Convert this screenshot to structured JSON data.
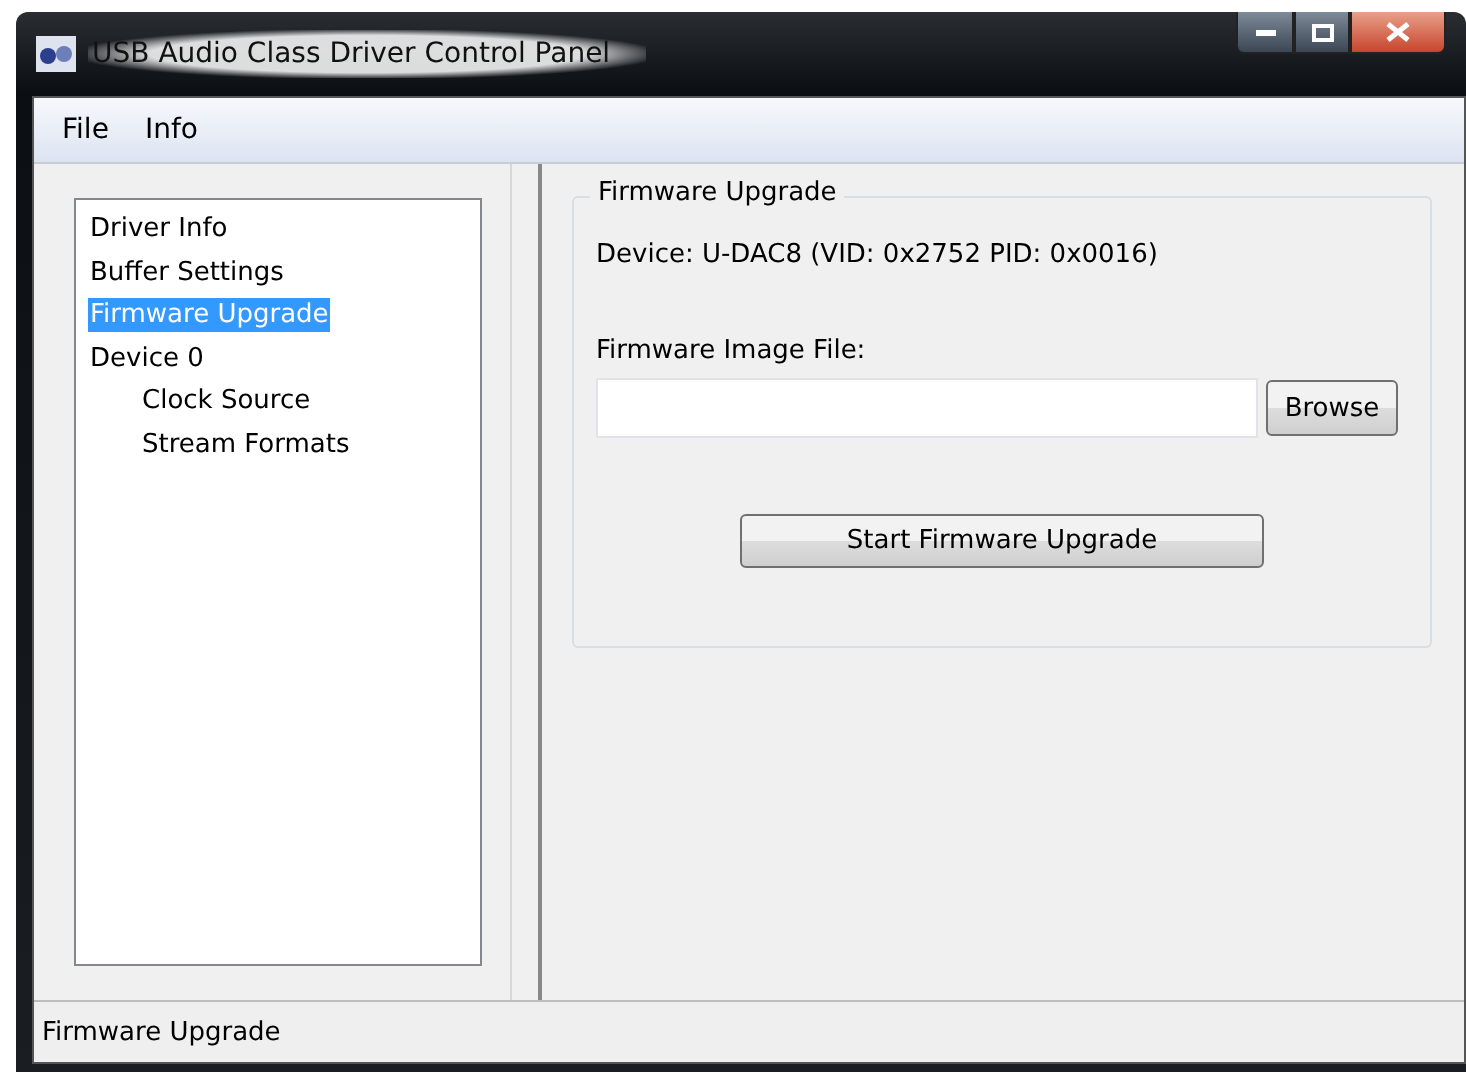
{
  "window": {
    "title": "USB Audio Class Driver Control Panel"
  },
  "menu": [
    "File",
    "Info"
  ],
  "tree": [
    {
      "label": "Driver Info",
      "selected": false
    },
    {
      "label": "Buffer Settings",
      "selected": false
    },
    {
      "label": "Firmware Upgrade",
      "selected": true
    },
    {
      "label": "Device 0",
      "selected": false,
      "children": [
        {
          "label": "Clock Source",
          "selected": false
        },
        {
          "label": "Stream Formats",
          "selected": false
        }
      ]
    }
  ],
  "panel": {
    "group_title": "Firmware Upgrade",
    "device": "Device: U-DAC8 (VID: 0x2752 PID: 0x0016)",
    "file_label": "Firmware Image File:",
    "browse_button": "Browse",
    "start_button": "Start Firmware Upgrade"
  },
  "status_bar": "Firmware Upgrade"
}
